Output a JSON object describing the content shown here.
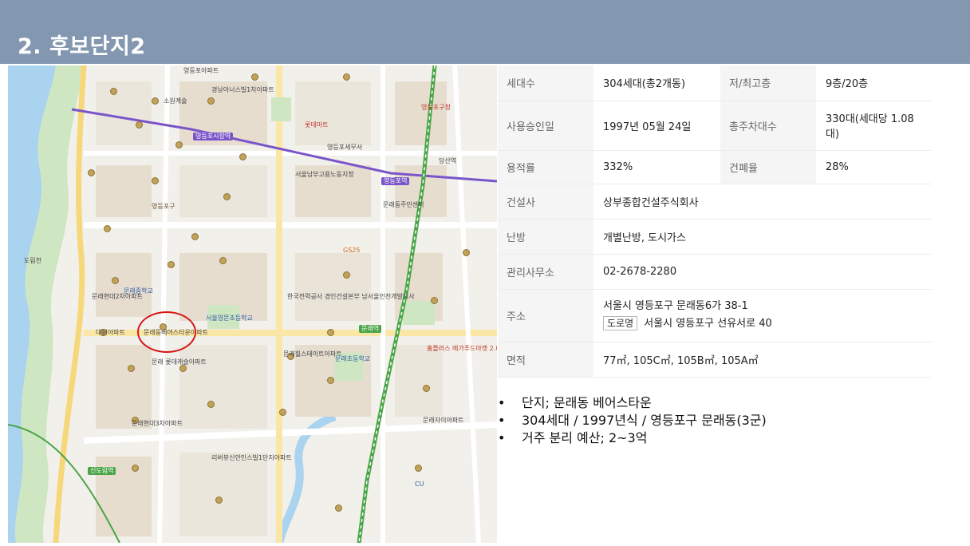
{
  "header": {
    "title": "2. 후보단지2"
  },
  "map": {
    "labels": [
      "영등포아파트",
      "소원계술",
      "경남아너스빌1차아파트",
      "영등포구청",
      "영등포역",
      "문래역",
      "문래동베어스타운아파트",
      "문래힐스테이트아파트",
      "문래자이아파트",
      "문래현대2차아파트",
      "문래중학교",
      "문래초등학교",
      "서울영문초등학교",
      "홈플러스 메가푸드마켓 2.0",
      "신도림역",
      "도림천",
      "영등포구",
      "한국전력공사 경인건설본부 남서울인천개발지사",
      "문래 롯데캐슬아파트",
      "문래현대3차아파트",
      "리버뷰신안인스빌1단지아파트",
      "영등포세무서",
      "영등포시장역",
      "서울남부고용노동지청",
      "대원아파트",
      "GS25",
      "CU",
      "롯데마트",
      "당산역",
      "문래동주민센터"
    ],
    "highlight_label": "문래동베어스타운아파트"
  },
  "info": {
    "rows": [
      {
        "label1": "세대수",
        "value1": "304세대(총2개동)",
        "label2": "저/최고층",
        "value2": "9층/20층"
      },
      {
        "label1": "사용승인일",
        "value1": "1997년 05월 24일",
        "label2": "총주차대수",
        "value2": "330대(세대당 1.08대)"
      },
      {
        "label1": "용적률",
        "value1": "332%",
        "label2": "건폐율",
        "value2": "28%"
      }
    ],
    "builder": {
      "label": "건설사",
      "value": "상부종합건설주식회사"
    },
    "heating": {
      "label": "난방",
      "value": "개별난방, 도시가스"
    },
    "office": {
      "label": "관리사무소",
      "value": "02-2678-2280"
    },
    "address": {
      "label": "주소",
      "jibun": "서울시 영등포구 문래동6가 38-1",
      "road_badge": "도로명",
      "road": "서울시 영등포구 선유서로 40"
    },
    "area": {
      "label": "면적",
      "value": "77㎡, 105C㎡, 105B㎡, 105A㎡"
    }
  },
  "bullets": [
    "단지; 문래동 베어스타운",
    "304세대 / 1997년식 / 영등포구 문래동(3군)",
    "거주 분리 예산; 2~3억"
  ],
  "colors": {
    "header_bg": "#8497b0",
    "river": "#a9d3ee",
    "park": "#cfe6c2",
    "subway_line2": "#4aa548",
    "subway_line5": "#7a55c9",
    "highlight": "#d81818"
  }
}
